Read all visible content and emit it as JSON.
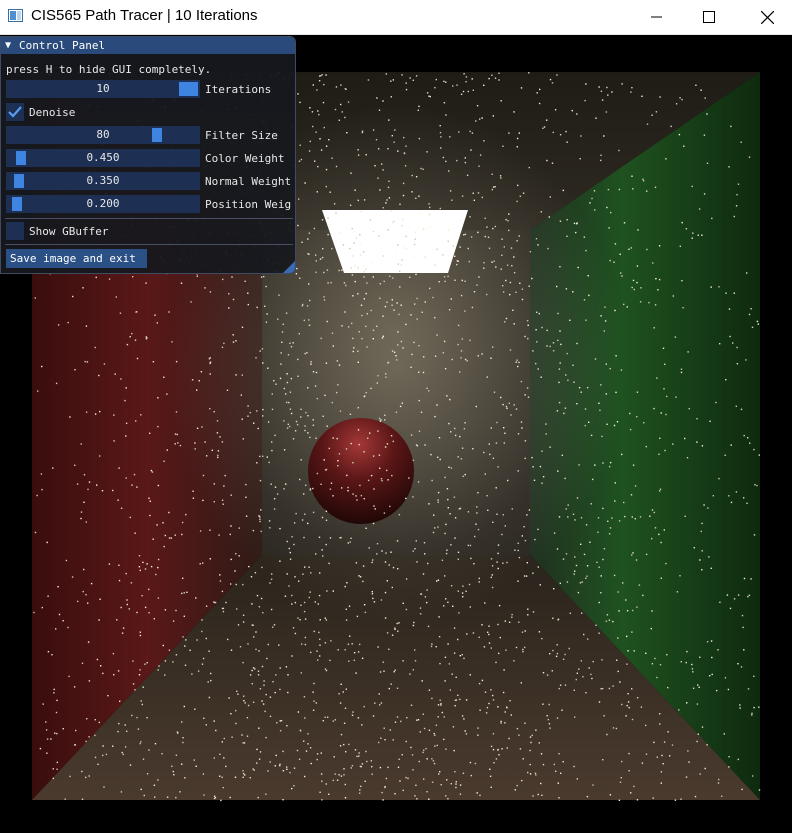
{
  "window": {
    "title": "CIS565 Path Tracer | 10 Iterations",
    "app_icon": "window-app-icon",
    "controls": [
      "minimize-icon",
      "maximize-icon",
      "close-icon"
    ]
  },
  "panel": {
    "title": "Control Panel",
    "collapse_icon": "triangle-down-icon",
    "hint": "press H to hide GUI completely.",
    "iterations": {
      "value": "10",
      "label": "Iterations",
      "fraction": 1.0
    },
    "denoise": {
      "label": "Denoise",
      "checked": true
    },
    "filter_size": {
      "value": "80",
      "label": "Filter Size",
      "fraction": 0.8
    },
    "color_weight": {
      "value": "0.450",
      "label": "Color Weight",
      "fraction": 0.045
    },
    "normal_weight": {
      "value": "0.350",
      "label": "Normal Weight",
      "fraction": 0.035
    },
    "position_weight": {
      "value": "0.200",
      "label": "Position Weig",
      "fraction": 0.02
    },
    "show_gbuffer": {
      "label": "Show GBuffer",
      "checked": false
    },
    "save_button": "Save image and exit"
  },
  "colors": {
    "header": "#294a7a",
    "slider_bg": "#1d3054",
    "slider_grab": "#3d85e0",
    "button": "#2a5086",
    "wall_left": "#5a1616",
    "wall_right": "#1f5a1f"
  }
}
